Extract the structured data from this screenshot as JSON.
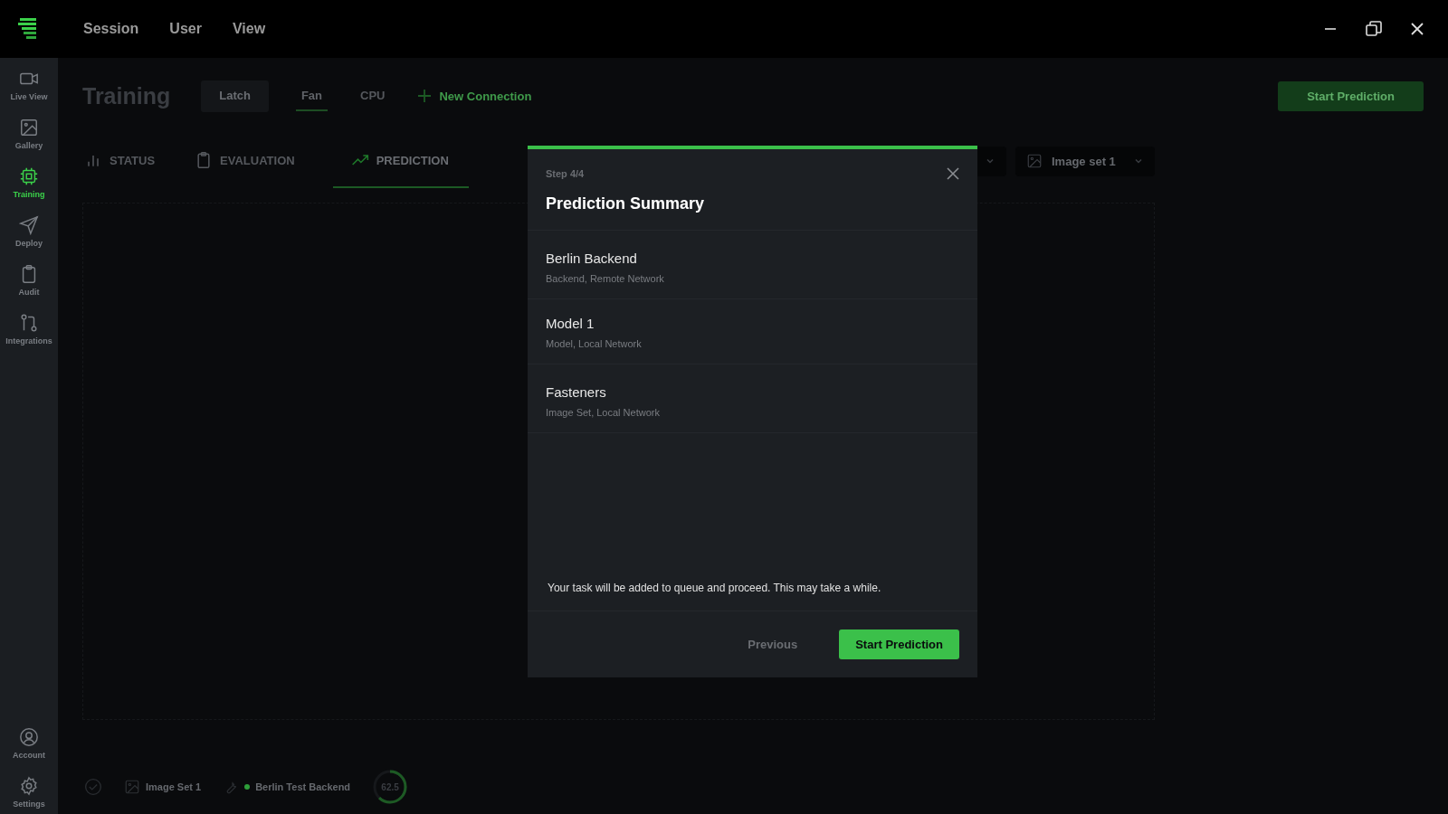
{
  "menu": [
    "Session",
    "User",
    "View"
  ],
  "sidebar": {
    "items": [
      {
        "label": "Live View",
        "selected": false
      },
      {
        "label": "Gallery",
        "selected": false
      },
      {
        "label": "Training",
        "selected": true
      },
      {
        "label": "Deploy",
        "selected": false
      },
      {
        "label": "Audit",
        "selected": false
      },
      {
        "label": "Integrations",
        "selected": false
      }
    ],
    "bottom_items": [
      {
        "label": "Account",
        "selected": false
      },
      {
        "label": "Settings",
        "selected": false
      }
    ]
  },
  "page": {
    "title": "Training",
    "connections": [
      {
        "label": "Latch",
        "kind": "chip",
        "selected": false
      },
      {
        "label": "Fan",
        "kind": "tab",
        "selected": true
      },
      {
        "label": "CPU",
        "kind": "tab",
        "selected": false
      }
    ],
    "new_connection": "New Connection",
    "start_button": "Start Prediction",
    "section_tabs": [
      {
        "label": "STATUS",
        "selected": false
      },
      {
        "label": "EVALUATION",
        "selected": false
      },
      {
        "label": "PREDICTION",
        "selected": true
      }
    ],
    "image_set_dropdown": "Image set 1"
  },
  "status_bar": {
    "image_set": "Image Set 1",
    "backend": "Berlin Test Backend",
    "score": "62.5",
    "level": 0.62
  },
  "dialog": {
    "step": "Step 4/4",
    "title": "Prediction Summary",
    "items": [
      {
        "name": "Berlin Backend",
        "detail": "Backend, Remote Network"
      },
      {
        "name": "Model 1",
        "detail": "Model, Local Network"
      },
      {
        "name": "Fasteners",
        "detail": "Image Set, Local Network"
      }
    ],
    "note": "Your task will be added to queue and proceed. This may take a while.",
    "buttons": [
      {
        "label": "Previous",
        "kind": "text"
      },
      {
        "label": "Start Prediction",
        "kind": "primary"
      }
    ]
  }
}
